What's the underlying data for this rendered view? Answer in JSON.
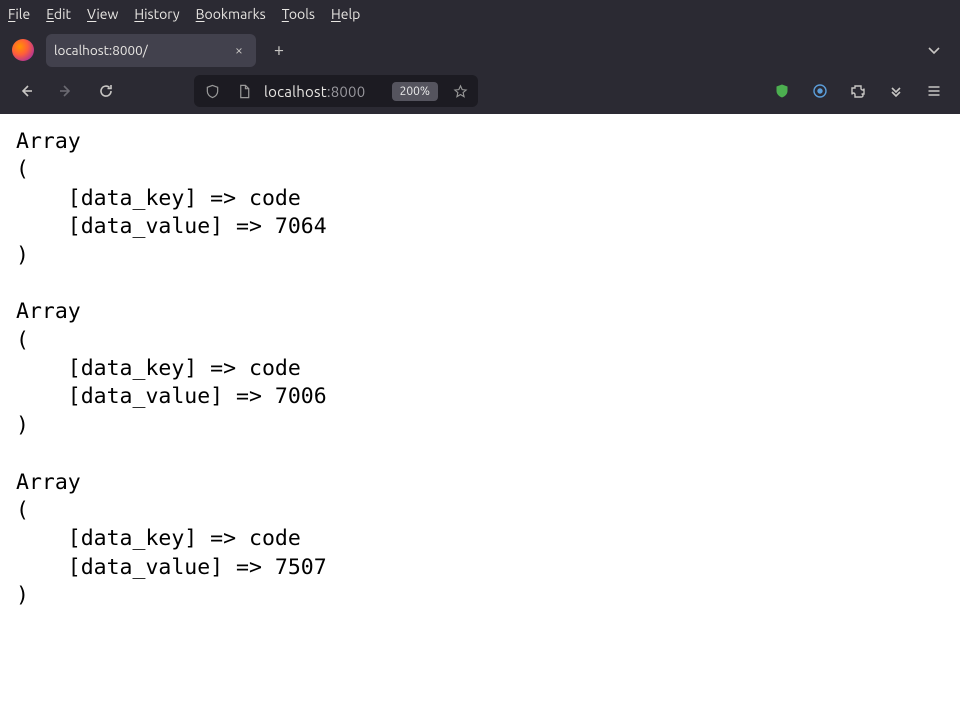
{
  "menu": {
    "file": "File",
    "edit": "Edit",
    "view": "View",
    "history": "History",
    "bookmarks": "Bookmarks",
    "tools": "Tools",
    "help": "Help"
  },
  "tab": {
    "title": "localhost:8000/",
    "close": "×",
    "newtab": "+"
  },
  "url": {
    "host": "localhost",
    "port": ":8000",
    "zoom": "200%"
  },
  "arrays": [
    {
      "key_label": "data_key",
      "key_value": "code",
      "value_label": "data_value",
      "value_value": "7064"
    },
    {
      "key_label": "data_key",
      "key_value": "code",
      "value_label": "data_value",
      "value_value": "7006"
    },
    {
      "key_label": "data_key",
      "key_value": "code",
      "value_label": "data_value",
      "value_value": "7507"
    }
  ]
}
